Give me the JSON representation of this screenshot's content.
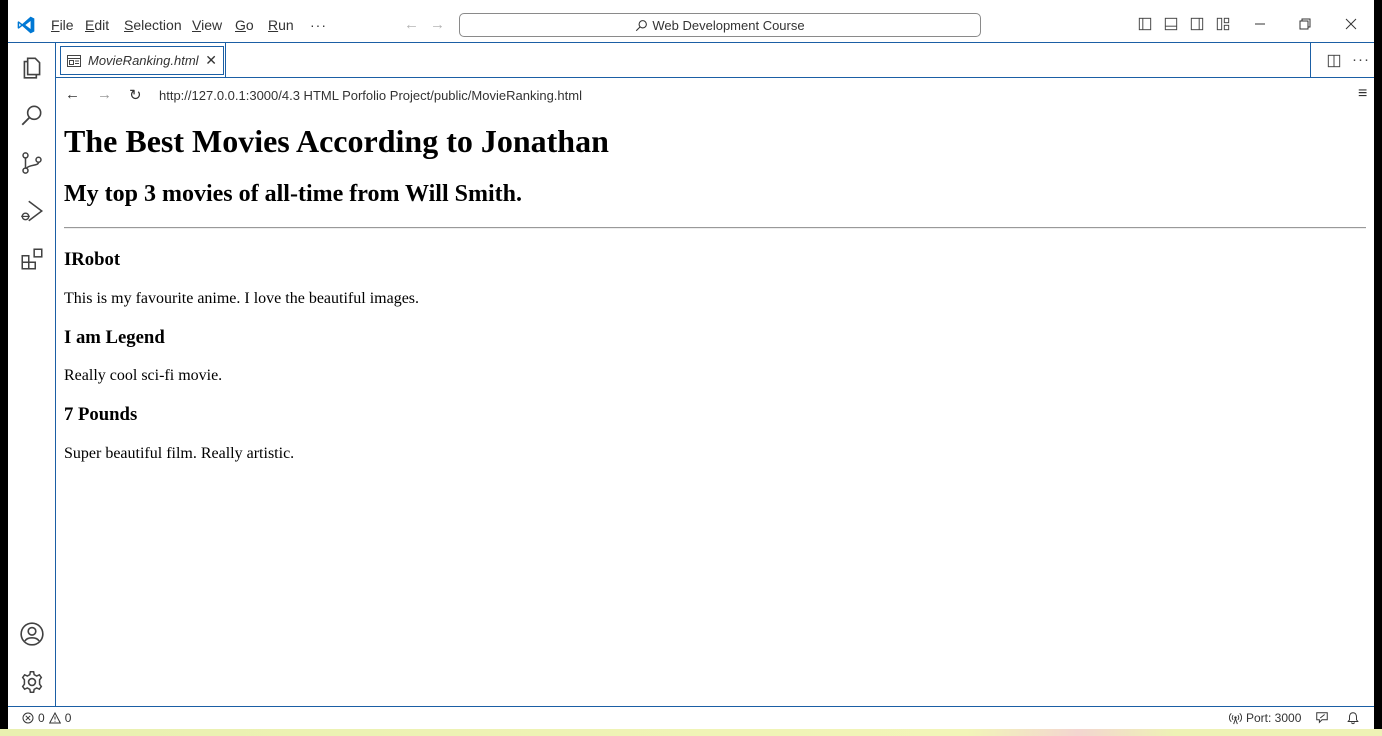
{
  "titlebar": {
    "menu": [
      {
        "label": "File",
        "mnemonic": "F"
      },
      {
        "label": "Edit",
        "mnemonic": "E"
      },
      {
        "label": "Selection",
        "mnemonic": "S"
      },
      {
        "label": "View",
        "mnemonic": "V"
      },
      {
        "label": "Go",
        "mnemonic": "G"
      },
      {
        "label": "Run",
        "mnemonic": "R"
      }
    ],
    "more": "···",
    "back": "←",
    "forward": "→",
    "search": "Web Development Course"
  },
  "tab": {
    "label": "MovieRanking.html",
    "close": "✕"
  },
  "browser": {
    "url": "http://127.0.0.1:3000/4.3 HTML Porfolio Project/public/MovieRanking.html",
    "back": "←",
    "forward": "→",
    "reload": "↻",
    "menu": "≡"
  },
  "page": {
    "h1": "The Best Movies According to Jonathan",
    "h2": "My top 3 movies of all-time from Will Smith.",
    "movies": [
      {
        "title": "IRobot",
        "description": "This is my favourite anime. I love the beautiful images."
      },
      {
        "title": "I am Legend",
        "description": "Really cool sci-fi movie."
      },
      {
        "title": "7 Pounds",
        "description": "Super beautiful film. Really artistic."
      }
    ]
  },
  "statusbar": {
    "errors": "0",
    "warnings": "0",
    "port": "Port: 3000"
  },
  "colors": {
    "accent": "#1b5fa5",
    "vscode_blue": "#0078d4"
  }
}
